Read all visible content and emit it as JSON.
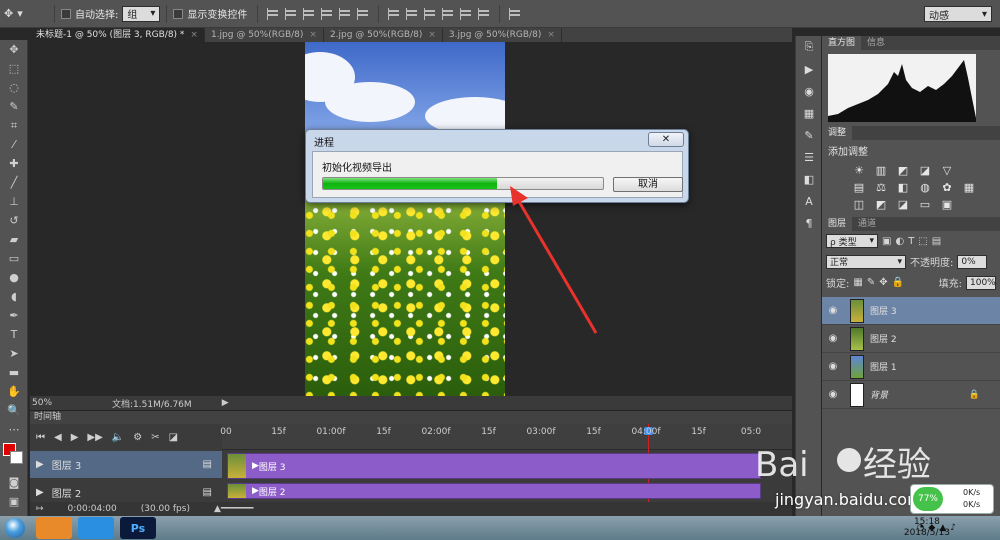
{
  "options_bar": {
    "auto_select_label": "自动选择:",
    "auto_select_value": "组",
    "show_transform_label": "显示变换控件",
    "workspace": "动感"
  },
  "doc_tabs": [
    {
      "label": "未标题-1 @ 50% (图层 3, RGB/8) *"
    },
    {
      "label": "1.jpg @ 50%(RGB/8)"
    },
    {
      "label": "2.jpg @ 50%(RGB/8)"
    },
    {
      "label": "3.jpg @ 50%(RGB/8)"
    }
  ],
  "status": {
    "zoom": "50%",
    "doc": "文档:1.51M/6.76M"
  },
  "dialog": {
    "title": "进程",
    "message": "初始化视频导出",
    "progress": 0.62,
    "cancel_label": "取消",
    "close_label": "✕"
  },
  "timeline": {
    "panel_title": "时间轴",
    "ruler_labels": [
      "00",
      "15f",
      "01:00f",
      "15f",
      "02:00f",
      "15f",
      "03:00f",
      "15f",
      "04:00f",
      "15f",
      "05:0"
    ],
    "layers": [
      {
        "name": "图层 3",
        "clip": "图层 3"
      },
      {
        "name": "图层 2",
        "clip": "图层 2"
      }
    ],
    "timecode": "0:00:04:00",
    "fps": "(30.00 fps)"
  },
  "panels": {
    "histogram_tabs": [
      "直方图",
      "信息"
    ],
    "adjust_tab": "调整",
    "adjust_label": "添加调整",
    "layers_tabs": [
      "图层",
      "通道"
    ],
    "filter_label": "ρ 类型",
    "blend_mode": "正常",
    "opacity_label": "不透明度:",
    "opacity_value": "0%",
    "lock_label": "锁定:",
    "fill_label": "填充:",
    "fill_value": "100%",
    "layers": [
      {
        "name": "图层 3",
        "active": true
      },
      {
        "name": "图层 2",
        "active": false
      },
      {
        "name": "图层 1",
        "active": false
      },
      {
        "name": "背景",
        "active": false
      }
    ]
  },
  "taskbar": {
    "time": "15:18",
    "date": "2018/5/13",
    "net_percent": "77%",
    "up_speed": "0K/s",
    "down_speed": "0K/s"
  },
  "watermark": {
    "text": "jingyan.baidu.com"
  },
  "colors": {
    "accent_progress": "#18c418",
    "clip": "#8c5cc8",
    "playhead": "#d02020",
    "foreground": "#e00000",
    "background": "#ffffff"
  }
}
